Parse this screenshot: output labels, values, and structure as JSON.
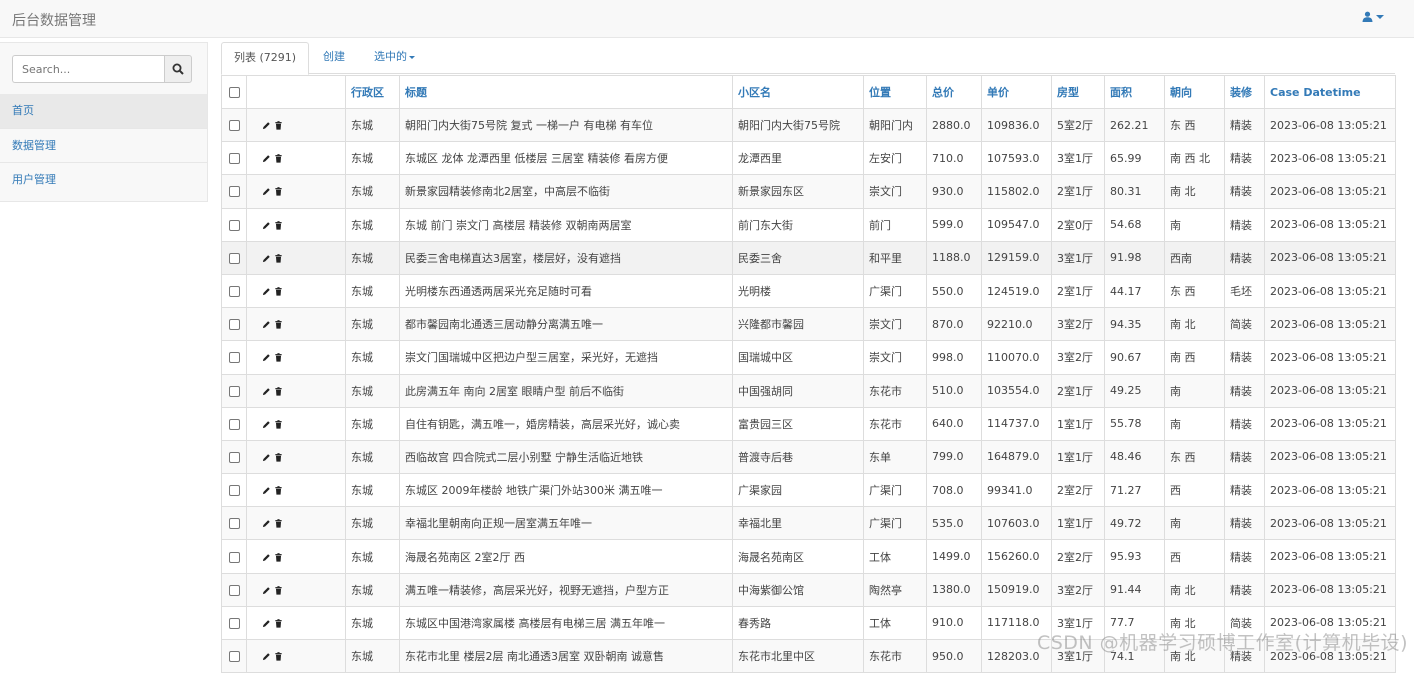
{
  "navbar": {
    "brand": "后台数据管理"
  },
  "search": {
    "placeholder": "Search..."
  },
  "sidebar": {
    "items": [
      {
        "label": "首页"
      },
      {
        "label": "数据管理"
      },
      {
        "label": "用户管理"
      }
    ]
  },
  "tabs": {
    "list": "列表 (7291)",
    "create": "创建",
    "selected": "选中的"
  },
  "table": {
    "headers": [
      "行政区",
      "标题",
      "小区名",
      "位置",
      "总价",
      "单价",
      "房型",
      "面积",
      "朝向",
      "装修",
      "Case Datetime"
    ],
    "rows": [
      [
        "东城",
        "朝阳门内大街75号院 复式 一梯一户 有电梯 有车位",
        "朝阳门内大街75号院",
        "朝阳门内",
        "2880.0",
        "109836.0",
        "5室2厅",
        "262.21",
        "东 西",
        "精装",
        "2023-06-08 13:05:21"
      ],
      [
        "东城",
        "东城区 龙体 龙潭西里 低楼层 三居室 精装修 看房方便",
        "龙潭西里",
        "左安门",
        "710.0",
        "107593.0",
        "3室1厅",
        "65.99",
        "南 西 北",
        "精装",
        "2023-06-08 13:05:21"
      ],
      [
        "东城",
        "新景家园精装修南北2居室，中高层不临街",
        "新景家园东区",
        "崇文门",
        "930.0",
        "115802.0",
        "2室1厅",
        "80.31",
        "南 北",
        "精装",
        "2023-06-08 13:05:21"
      ],
      [
        "东城",
        "东城 前门 崇文门 高楼层 精装修 双朝南两居室",
        "前门东大街",
        "前门",
        "599.0",
        "109547.0",
        "2室0厅",
        "54.68",
        "南",
        "精装",
        "2023-06-08 13:05:21"
      ],
      [
        "东城",
        "民委三舍电梯直达3居室，楼层好，没有遮挡",
        "民委三舍",
        "和平里",
        "1188.0",
        "129159.0",
        "3室1厅",
        "91.98",
        "西南",
        "精装",
        "2023-06-08 13:05:21"
      ],
      [
        "东城",
        "光明楼东西通透两居采光充足随时可看",
        "光明楼",
        "广渠门",
        "550.0",
        "124519.0",
        "2室1厅",
        "44.17",
        "东 西",
        "毛坯",
        "2023-06-08 13:05:21"
      ],
      [
        "东城",
        "都市馨园南北通透三居动静分离满五唯一",
        "兴隆都市馨园",
        "崇文门",
        "870.0",
        "92210.0",
        "3室2厅",
        "94.35",
        "南 北",
        "简装",
        "2023-06-08 13:05:21"
      ],
      [
        "东城",
        "崇文门国瑞城中区把边户型三居室，采光好，无遮挡",
        "国瑞城中区",
        "崇文门",
        "998.0",
        "110070.0",
        "3室2厅",
        "90.67",
        "南 西",
        "精装",
        "2023-06-08 13:05:21"
      ],
      [
        "东城",
        "此房满五年 南向 2居室 眼睛户型 前后不临街",
        "中国强胡同",
        "东花市",
        "510.0",
        "103554.0",
        "2室1厅",
        "49.25",
        "南",
        "精装",
        "2023-06-08 13:05:21"
      ],
      [
        "东城",
        "自住有钥匙，满五唯一，婚房精装，高层采光好，诚心卖",
        "富贵园三区",
        "东花市",
        "640.0",
        "114737.0",
        "1室1厅",
        "55.78",
        "南",
        "精装",
        "2023-06-08 13:05:21"
      ],
      [
        "东城",
        "西临故宫 四合院式二层小别墅 宁静生活临近地铁",
        "普渡寺后巷",
        "东单",
        "799.0",
        "164879.0",
        "1室1厅",
        "48.46",
        "东 西",
        "精装",
        "2023-06-08 13:05:21"
      ],
      [
        "东城",
        "东城区 2009年楼龄 地铁广渠门外站300米 满五唯一",
        "广渠家园",
        "广渠门",
        "708.0",
        "99341.0",
        "2室2厅",
        "71.27",
        "西",
        "精装",
        "2023-06-08 13:05:21"
      ],
      [
        "东城",
        "幸福北里朝南向正规一居室满五年唯一",
        "幸福北里",
        "广渠门",
        "535.0",
        "107603.0",
        "1室1厅",
        "49.72",
        "南",
        "精装",
        "2023-06-08 13:05:21"
      ],
      [
        "东城",
        "海晟名苑南区 2室2厅 西",
        "海晟名苑南区",
        "工体",
        "1499.0",
        "156260.0",
        "2室2厅",
        "95.93",
        "西",
        "精装",
        "2023-06-08 13:05:21"
      ],
      [
        "东城",
        "满五唯一精装修，高层采光好，视野无遮挡，户型方正",
        "中海紫御公馆",
        "陶然亭",
        "1380.0",
        "150919.0",
        "3室2厅",
        "91.44",
        "南 北",
        "精装",
        "2023-06-08 13:05:21"
      ],
      [
        "东城",
        "东城区中国港湾家属楼 高楼层有电梯三居 满五年唯一",
        "春秀路",
        "工体",
        "910.0",
        "117118.0",
        "3室1厅",
        "77.7",
        "南 北",
        "简装",
        "2023-06-08 13:05:21"
      ],
      [
        "东城",
        "东花市北里 楼层2层 南北通透3居室 双卧朝南 诚意售",
        "东花市北里中区",
        "东花市",
        "950.0",
        "128203.0",
        "3室1厅",
        "74.1",
        "南 北",
        "精装",
        "2023-06-08 13:05:21"
      ]
    ]
  },
  "watermark": "CSDN @机器学习硕博工作室(计算机毕设)"
}
